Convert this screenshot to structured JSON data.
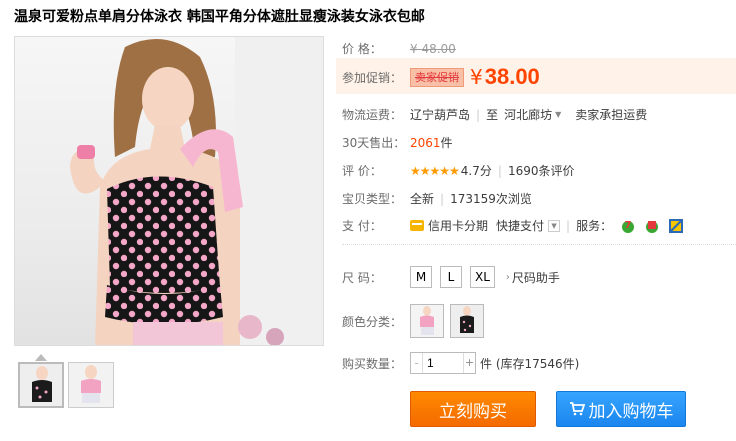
{
  "title": "温泉可爱粉点单肩分体泳衣 韩国平角分体遮肚显瘦泳装女泳衣包邮",
  "price": {
    "label": "价 格：",
    "value": "¥ 48.00"
  },
  "promo": {
    "label": "参加促销：",
    "tag": "卖家促销",
    "yen": "¥",
    "value": "38.00"
  },
  "shipping": {
    "label": "物流运费：",
    "from": "辽宁葫芦岛",
    "to_label": "至",
    "to": "河北廊坊",
    "fee": "卖家承担运费"
  },
  "sales": {
    "label": "30天售出：",
    "count": "2061",
    "unit": "件"
  },
  "rating": {
    "label": "评 价：",
    "stars": "★★★★★",
    "score": "4.7分",
    "reviews": "1690条评价"
  },
  "item_type": {
    "label": "宝贝类型：",
    "condition": "全新",
    "views": "173159次浏览"
  },
  "payment": {
    "label": "支 付：",
    "credit": "信用卡分期",
    "quick": "快捷支付",
    "service_label": "服务："
  },
  "size": {
    "label": "尺 码：",
    "options": [
      "M",
      "L",
      "XL"
    ],
    "helper": "尺码助手"
  },
  "color": {
    "label": "颜色分类："
  },
  "quantity": {
    "label": "购买数量：",
    "value": "1",
    "stock": "件 (库存17546件)"
  },
  "buttons": {
    "buy_now": "立刻购买",
    "add_cart": "加入购物车"
  },
  "colors": {
    "accent": "#ff4400",
    "buy": "#f46a00",
    "cart": "#1a86ef"
  }
}
